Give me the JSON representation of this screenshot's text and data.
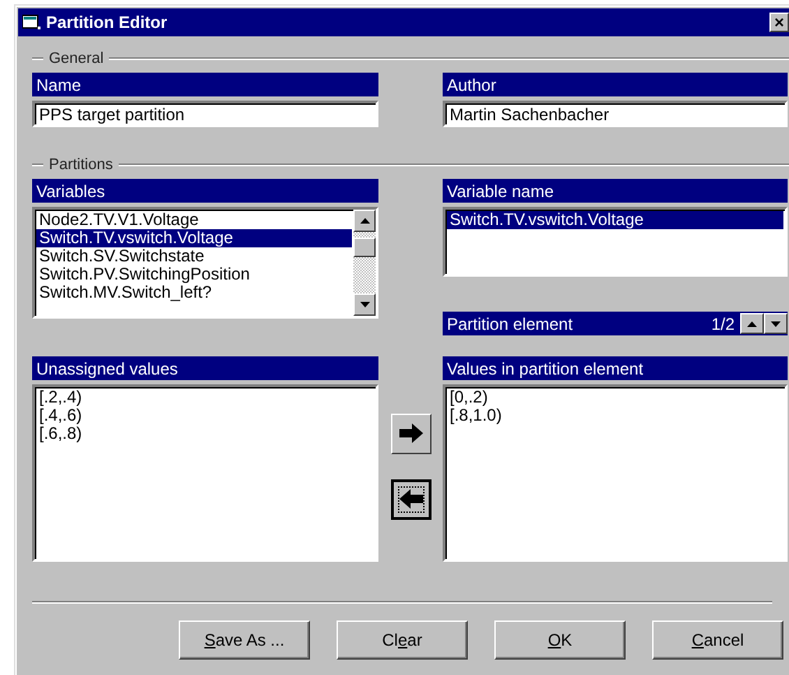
{
  "window": {
    "title": "Partition Editor",
    "close": "×"
  },
  "general": {
    "legend": "General",
    "name": {
      "label": "Name",
      "value": "PPS target partition"
    },
    "author": {
      "label": "Author",
      "value": "Martin Sachenbacher"
    }
  },
  "partitions": {
    "legend": "Partitions",
    "variables": {
      "label": "Variables",
      "items": [
        {
          "text": "Node2.TV.V1.Voltage",
          "selected": false
        },
        {
          "text": "Switch.TV.vswitch.Voltage",
          "selected": true
        },
        {
          "text": "Switch.SV.Switchstate",
          "selected": false
        },
        {
          "text": "Switch.PV.SwitchingPosition",
          "selected": false
        },
        {
          "text": "Switch.MV.Switch_left?",
          "selected": false
        }
      ]
    },
    "variable_name": {
      "label": "Variable name",
      "items": [
        {
          "text": "Switch.TV.vswitch.Voltage",
          "selected": true
        }
      ]
    },
    "partition_element": {
      "label": "Partition element",
      "counter": "1/2"
    },
    "unassigned": {
      "label": "Unassigned values",
      "items": [
        {
          "text": "[.2,.4)",
          "selected": false
        },
        {
          "text": "[.4,.6)",
          "selected": false
        },
        {
          "text": "[.6,.8)",
          "selected": false
        }
      ]
    },
    "assigned": {
      "label": "Values in partition element",
      "items": [
        {
          "text": "[0,.2)",
          "selected": false
        },
        {
          "text": "[.8,1.0)",
          "selected": false
        }
      ]
    }
  },
  "buttons": [
    {
      "key": "S",
      "after": "ave As ..."
    },
    {
      "before": "Cl",
      "key": "e",
      "after": "ar"
    },
    {
      "key": "O",
      "after": "K"
    },
    {
      "key": "C",
      "after": "ancel"
    }
  ]
}
